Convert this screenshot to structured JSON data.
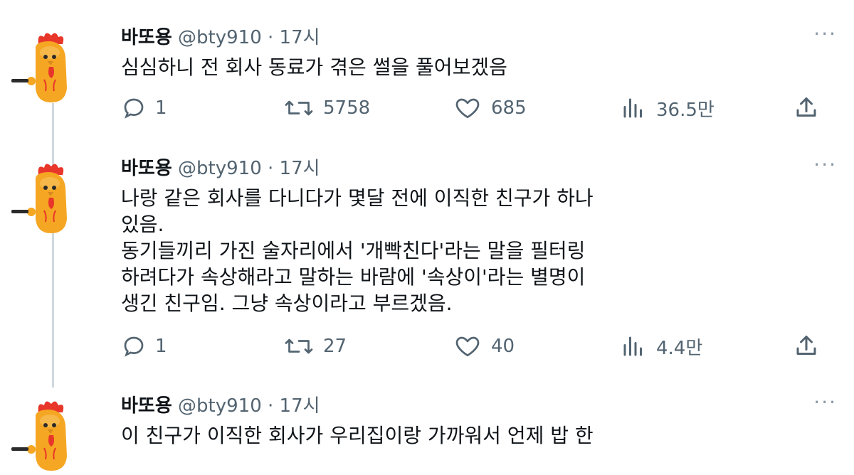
{
  "tweets": [
    {
      "name": "바또용",
      "handle": "@bty910",
      "sep": "·",
      "time": "17시",
      "more": "···",
      "lines": [
        "심심하니 전 회사 동료가 겪은 썰을 풀어보겠음"
      ],
      "replies": "1",
      "retweets": "5758",
      "likes": "685",
      "views": "36.5만"
    },
    {
      "name": "바또용",
      "handle": "@bty910",
      "sep": "·",
      "time": "17시",
      "more": "···",
      "lines": [
        "나랑 같은 회사를 다니다가 몇달 전에 이직한 친구가 하나",
        "있음.",
        "동기들끼리 가진 술자리에서 '개빡친다'라는 말을 필터링",
        "하려다가 속상해라고 말하는 바람에 '속상이'라는 별명이",
        "생긴 친구임. 그냥 속상이라고 부르겠음."
      ],
      "replies": "1",
      "retweets": "27",
      "likes": "40",
      "views": "4.4만"
    },
    {
      "name": "바또용",
      "handle": "@bty910",
      "sep": "·",
      "time": "17시",
      "more": "···",
      "lines": [
        "이 친구가 이직한 회사가 우리집이랑 가까워서 언제 밥 한"
      ]
    }
  ],
  "icons": {
    "reply": "reply-icon",
    "retweet": "retweet-icon",
    "like": "heart-icon",
    "views": "views-icon",
    "share": "share-icon"
  },
  "colors": {
    "text": "#0f1419",
    "secondary": "#536471",
    "thread_line": "#cfd9de",
    "avatar_body": "#f5a623",
    "avatar_comb": "#e8372a"
  }
}
